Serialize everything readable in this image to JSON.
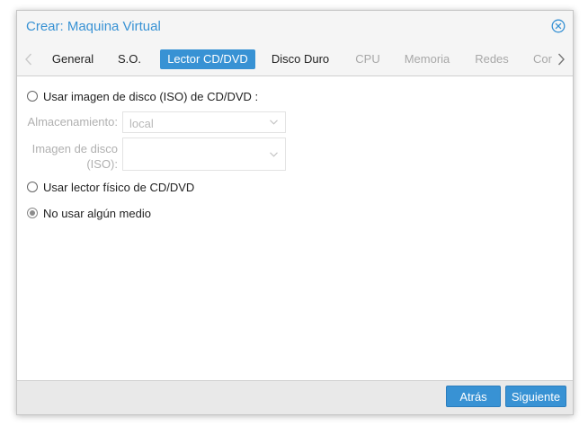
{
  "window": {
    "title": "Crear: Maquina Virtual"
  },
  "tabs": [
    {
      "label": "General",
      "state": "enabled"
    },
    {
      "label": "S.O.",
      "state": "enabled"
    },
    {
      "label": "Lector CD/DVD",
      "state": "active"
    },
    {
      "label": "Disco Duro",
      "state": "enabled"
    },
    {
      "label": "CPU",
      "state": "disabled"
    },
    {
      "label": "Memoria",
      "state": "disabled"
    },
    {
      "label": "Redes",
      "state": "disabled"
    },
    {
      "label": "Cor",
      "state": "disabled"
    }
  ],
  "form": {
    "iso_option": {
      "label": "Usar imagen de disco (ISO) de CD/DVD :",
      "checked": false
    },
    "storage": {
      "label": "Almacenamiento:",
      "value": "local"
    },
    "iso_image": {
      "label_line1": "Imagen de disco",
      "label_line2": "(ISO):",
      "value": ""
    },
    "physical_option": {
      "label": "Usar lector físico de CD/DVD",
      "checked": false
    },
    "none_option": {
      "label": "No usar algún medio",
      "checked": true
    }
  },
  "footer": {
    "back_label": "Atrás",
    "next_label": "Siguiente"
  },
  "colors": {
    "accent": "#3892d4",
    "disabled_text": "#a8a8a8"
  },
  "icons": {
    "close": "close-circle-icon",
    "scroll_left": "chevron-left-icon",
    "scroll_right": "chevron-right-icon",
    "combo_trigger": "chevron-down-icon"
  }
}
